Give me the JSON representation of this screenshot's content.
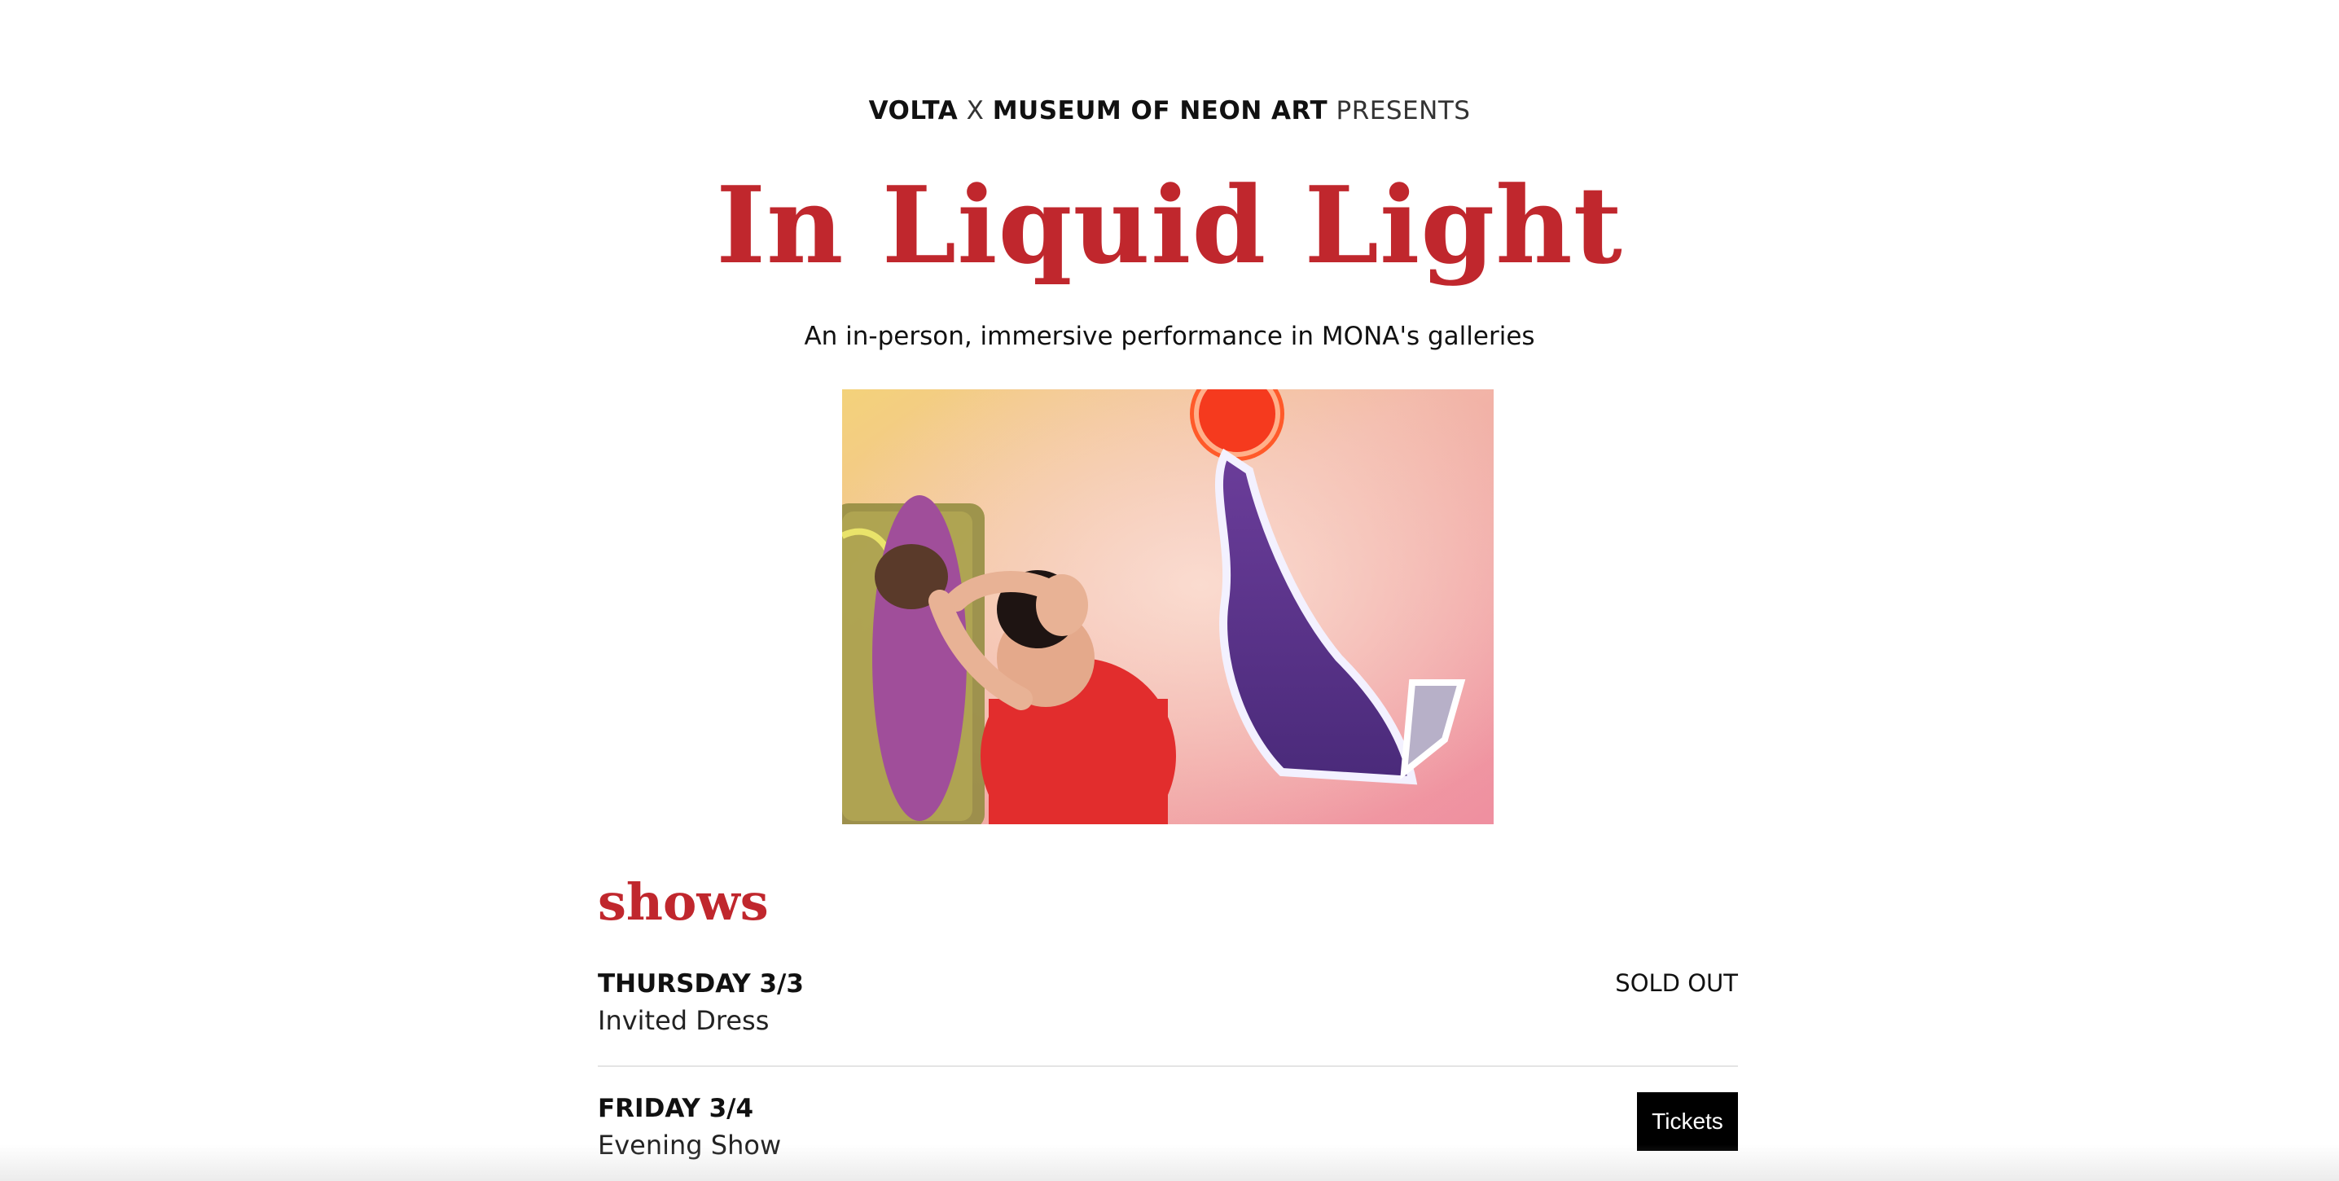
{
  "header": {
    "presenter_1": "VOLTA",
    "separator": "X",
    "presenter_2": "MUSEUM OF NEON ART",
    "presents": "PRESENTS"
  },
  "hero": {
    "title": "In Liquid Light",
    "subtitle": "An in-person, immersive performance in MONA's galleries"
  },
  "shows": {
    "heading": "shows",
    "items": [
      {
        "day": "THURSDAY 3/3",
        "name": "Invited Dress",
        "status": "SOLD OUT"
      },
      {
        "day": "FRIDAY 3/4",
        "name": "Evening Show",
        "button": "Tickets"
      }
    ]
  },
  "colors": {
    "accent": "#c0272d",
    "button_bg": "#000000",
    "button_text": "#ffffff"
  }
}
